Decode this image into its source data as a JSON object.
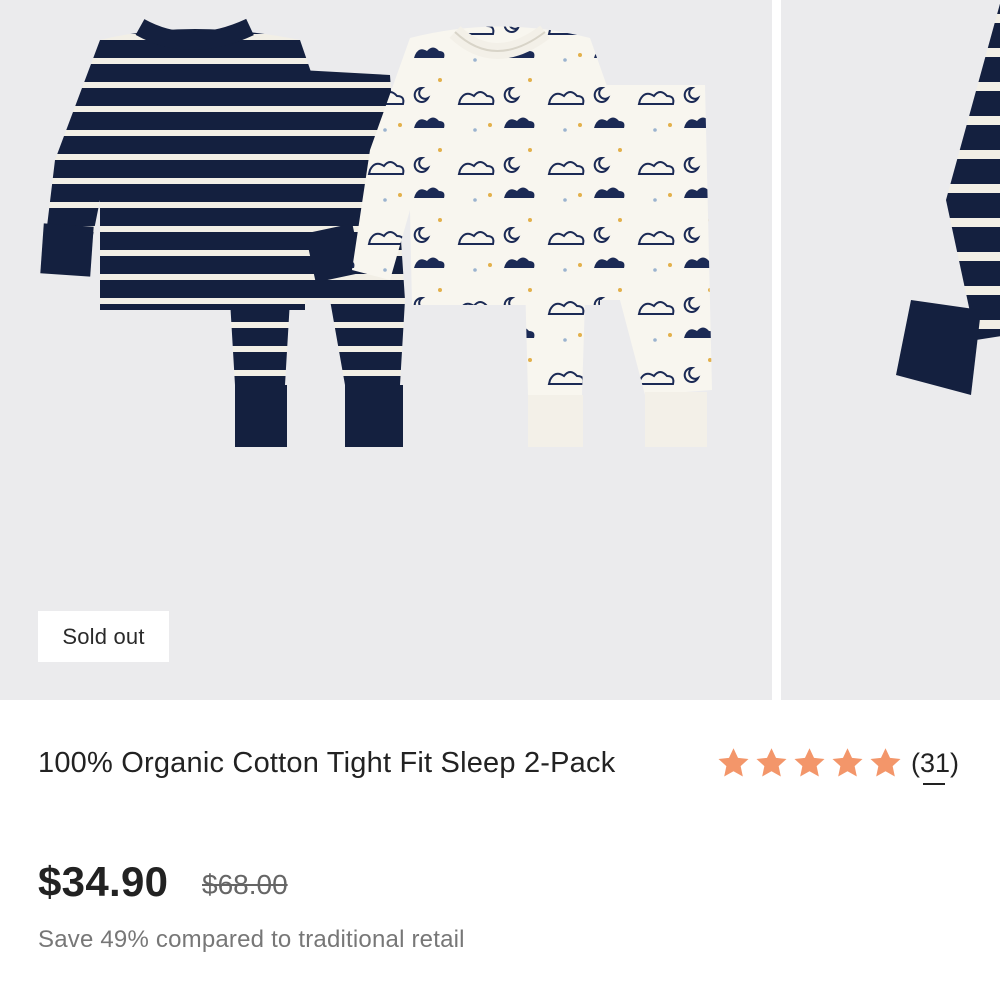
{
  "gallery": {
    "badge": "Sold out"
  },
  "product": {
    "title": "100% Organic Cotton Tight Fit Sleep 2-Pack",
    "price": "$34.90",
    "original_price": "$68.00",
    "savings_text": "Save 49% compared to traditional retail"
  },
  "rating": {
    "stars": 5,
    "review_count": "(31)",
    "star_color": "#f3966a"
  },
  "colors": {
    "navy": "#14203f",
    "cream": "#f8f6ef",
    "image_bg": "#ebebed"
  }
}
